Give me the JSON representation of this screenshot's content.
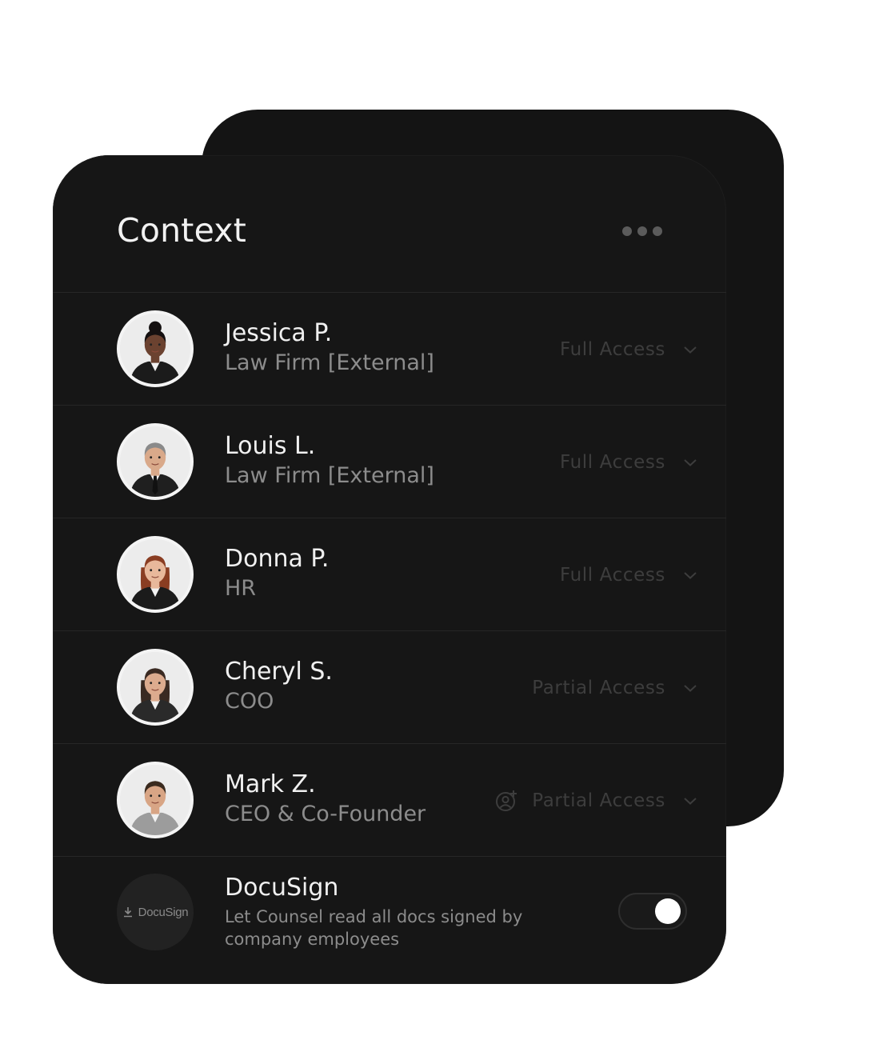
{
  "panel": {
    "title": "Context",
    "menu_icon": "more-horizontal-icon"
  },
  "people": [
    {
      "name": "Jessica P.",
      "role": "Law Firm [External]",
      "access": "Full Access",
      "skin": "#6b4230",
      "hair": "#141010",
      "hair_style": "bun",
      "suit": "#1b1b1b",
      "has_tie": false,
      "invite_icon": false
    },
    {
      "name": "Louis L.",
      "role": "Law Firm [External]",
      "access": "Full Access",
      "skin": "#d9a98a",
      "hair": "#8a8a8a",
      "hair_style": "short",
      "suit": "#1f1f1f",
      "has_tie": true,
      "invite_icon": false
    },
    {
      "name": "Donna P.",
      "role": "HR",
      "access": "Full Access",
      "skin": "#e8b89b",
      "hair": "#8a3d22",
      "hair_style": "long",
      "suit": "#1b1b1b",
      "has_tie": false,
      "invite_icon": false
    },
    {
      "name": "Cheryl S.",
      "role": "COO",
      "access": "Partial Access",
      "skin": "#dcab8e",
      "hair": "#3a2a22",
      "hair_style": "long",
      "suit": "#2a2a2a",
      "has_tie": false,
      "invite_icon": false
    },
    {
      "name": "Mark Z.",
      "role": "CEO & Co-Founder",
      "access": "Partial Access",
      "skin": "#d8a585",
      "hair": "#3a2a1e",
      "hair_style": "short",
      "suit": "#9c9c9c",
      "has_tie": false,
      "invite_icon": true
    }
  ],
  "integration": {
    "name": "DocuSign",
    "logo_text": "DocuSign",
    "description": "Let Counsel read all docs signed by company employees",
    "enabled": true
  }
}
